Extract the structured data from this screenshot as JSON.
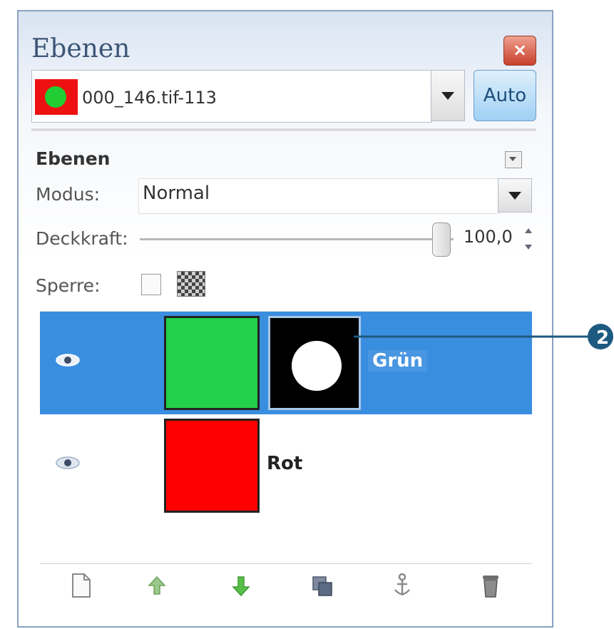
{
  "panel": {
    "title": "Ebenen",
    "close_label": "×"
  },
  "image_selector": {
    "name": "000_146.tif-113",
    "auto_label": "Auto"
  },
  "layers_section": {
    "title": "Ebenen",
    "mode_label": "Modus:",
    "mode_value": "Normal",
    "opacity_label": "Deckkraft:",
    "opacity_value": "100,0",
    "opacity_fraction": 1.0,
    "lock_label": "Sperre:"
  },
  "layers": [
    {
      "name": "Grün",
      "selected": true,
      "visible": true,
      "color": "#22d04a",
      "has_mask": true
    },
    {
      "name": "Rot",
      "selected": false,
      "visible": true,
      "color": "#ff0000",
      "has_mask": false
    }
  ],
  "callout": {
    "number": "2"
  },
  "toolbar": {
    "buttons": [
      "new-layer-icon",
      "raise-layer-icon",
      "lower-layer-icon",
      "duplicate-layer-icon",
      "anchor-layer-icon",
      "delete-layer-icon"
    ]
  },
  "colors": {
    "selection": "#3a8ee0",
    "callout": "#1d5a80"
  }
}
